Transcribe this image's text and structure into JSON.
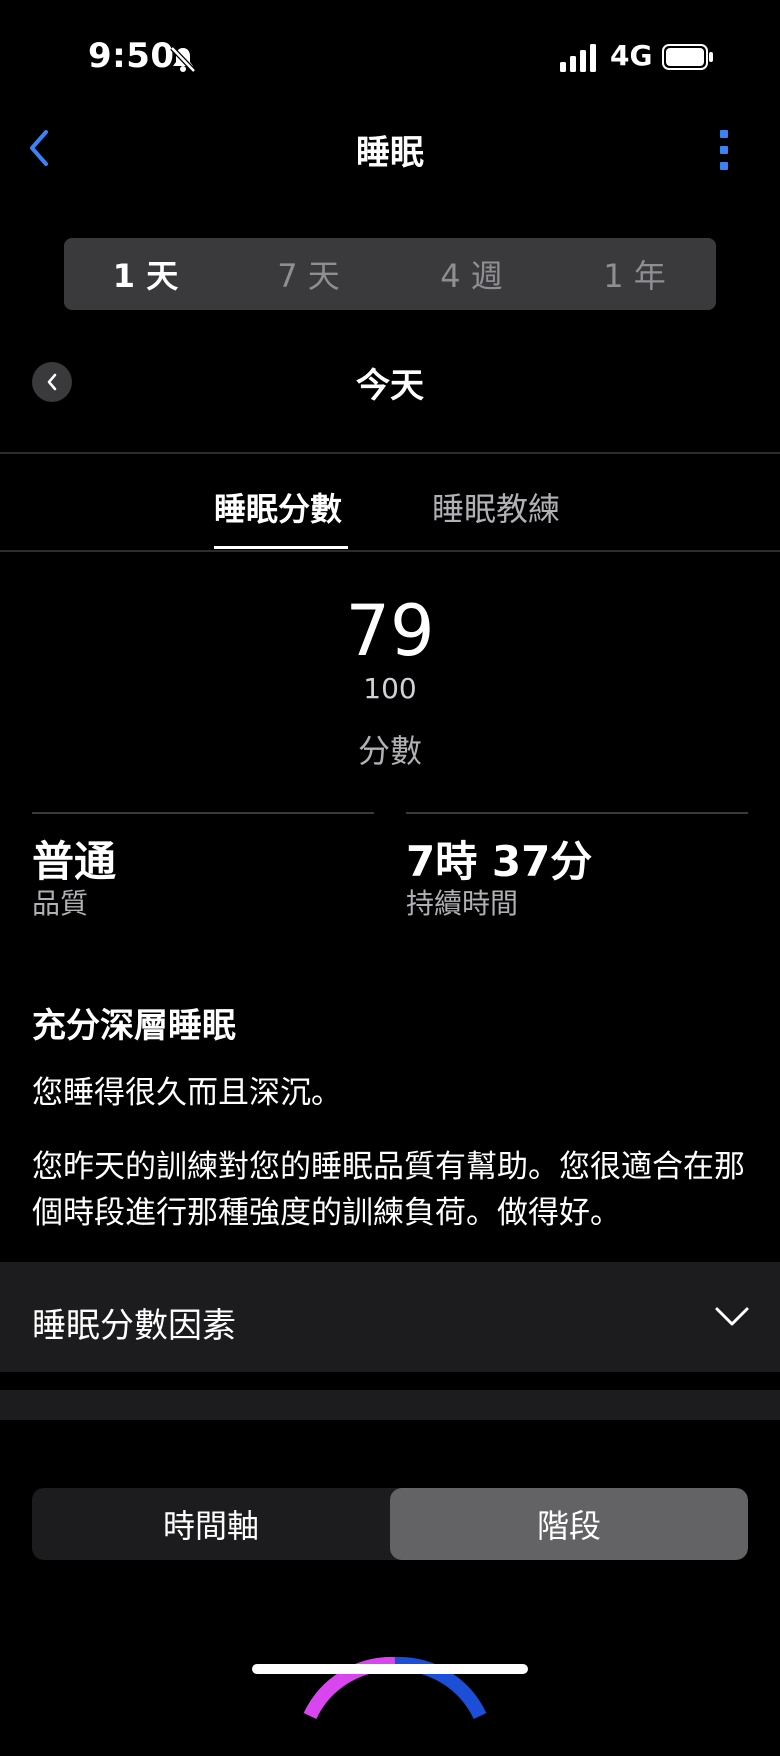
{
  "status": {
    "time": "9:50",
    "network": "4G"
  },
  "header": {
    "title": "睡眠"
  },
  "range_tabs": [
    {
      "label": "1 天",
      "active": true
    },
    {
      "label": "7 天",
      "active": false
    },
    {
      "label": "4 週",
      "active": false
    },
    {
      "label": "1 年",
      "active": false
    }
  ],
  "date_nav": {
    "label": "今天"
  },
  "tabs": [
    {
      "label": "睡眠分數",
      "active": true
    },
    {
      "label": "睡眠教練",
      "active": false
    }
  ],
  "score": {
    "value": "79",
    "max": "100",
    "label": "分數"
  },
  "stats": {
    "quality": {
      "value": "普通",
      "label": "品質"
    },
    "duration": {
      "value": "7時 37分",
      "label": "持續時間"
    }
  },
  "insight": {
    "title": "充分深層睡眠",
    "p1": "您睡得很久而且深沉。",
    "p2": "您昨天的訓練對您的睡眠品質有幫助。您很適合在那個時段進行那種強度的訓練負荷。做得好。"
  },
  "factors": {
    "label": "睡眠分數因素"
  },
  "view_toggle": [
    {
      "label": "時間軸",
      "active": false
    },
    {
      "label": "階段",
      "active": true
    }
  ],
  "colors": {
    "accent": "#3b82f6",
    "background": "#000000",
    "panel": "#1c1c1e"
  }
}
